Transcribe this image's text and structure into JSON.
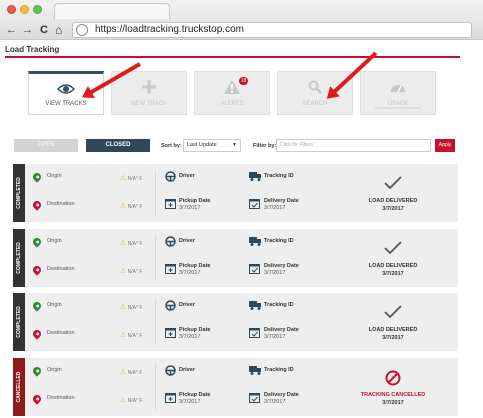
{
  "browser": {
    "back_glyph": "←",
    "forward_glyph": "→",
    "reload_glyph": "C",
    "home_glyph": "⌂",
    "url": "https://loadtracking.truckstop.com"
  },
  "page": {
    "title": "Load Tracking",
    "accent_color": "#c8102e"
  },
  "tabs": [
    {
      "label": "VIEW TRACKS",
      "icon": "eye-icon",
      "active": true
    },
    {
      "label": "NEW TRACK",
      "icon": "plus-icon",
      "active": false
    },
    {
      "label": "ALERTS",
      "icon": "alert-icon",
      "active": false,
      "badge": "18"
    },
    {
      "label": "SEARCH",
      "icon": "search-icon",
      "active": false
    },
    {
      "label": "USAGE",
      "icon": "gauge-icon",
      "active": false
    }
  ],
  "filters": {
    "open_label": "OPEN",
    "closed_label": "CLOSED",
    "sort_label": "Sort by:",
    "sort_value": "Last Update",
    "filter_label": "Filter by:",
    "filter_placeholder": "Click for Filters",
    "apply_label": "Apply"
  },
  "loads": [
    {
      "status": "COMPLETED",
      "origin_label": "Origin",
      "destination_label": "Destination",
      "temp": "N/A° F",
      "driver_label": "Driver",
      "tracking_label": "Tracking ID",
      "pickup_label": "Pickup Date",
      "pickup_date": "3/7/2017",
      "delivery_label": "Delivery Date",
      "delivery_date": "3/7/2017",
      "outcome": "LOAD DELIVERED",
      "outcome_date": "3/7/2017"
    },
    {
      "status": "COMPLETED",
      "origin_label": "Origin",
      "destination_label": "Destination",
      "temp": "N/A° F",
      "driver_label": "Driver",
      "tracking_label": "Tracking ID",
      "pickup_label": "Pickup Date",
      "pickup_date": "3/7/2017",
      "delivery_label": "Delivery Date",
      "delivery_date": "3/7/2017",
      "outcome": "LOAD DELIVERED",
      "outcome_date": "3/7/2017"
    },
    {
      "status": "COMPLETED",
      "origin_label": "Origin",
      "destination_label": "Destination",
      "temp": "N/A° F",
      "driver_label": "Driver",
      "tracking_label": "Tracking ID",
      "pickup_label": "Pickup Date",
      "pickup_date": "3/7/2017",
      "delivery_label": "Delivery Date",
      "delivery_date": "3/7/2017",
      "outcome": "LOAD DELIVERED",
      "outcome_date": "3/7/2017"
    },
    {
      "status": "CANCELLED",
      "origin_label": "Origin",
      "destination_label": "Destination",
      "temp": "N/A° F",
      "driver_label": "Driver",
      "tracking_label": "Tracking ID",
      "pickup_label": "Pickup Date",
      "pickup_date": "3/7/2017",
      "delivery_label": "Delivery Date",
      "delivery_date": "3/7/2017",
      "outcome": "TRACKING CANCELLED",
      "outcome_date": "3/7/2017"
    }
  ]
}
